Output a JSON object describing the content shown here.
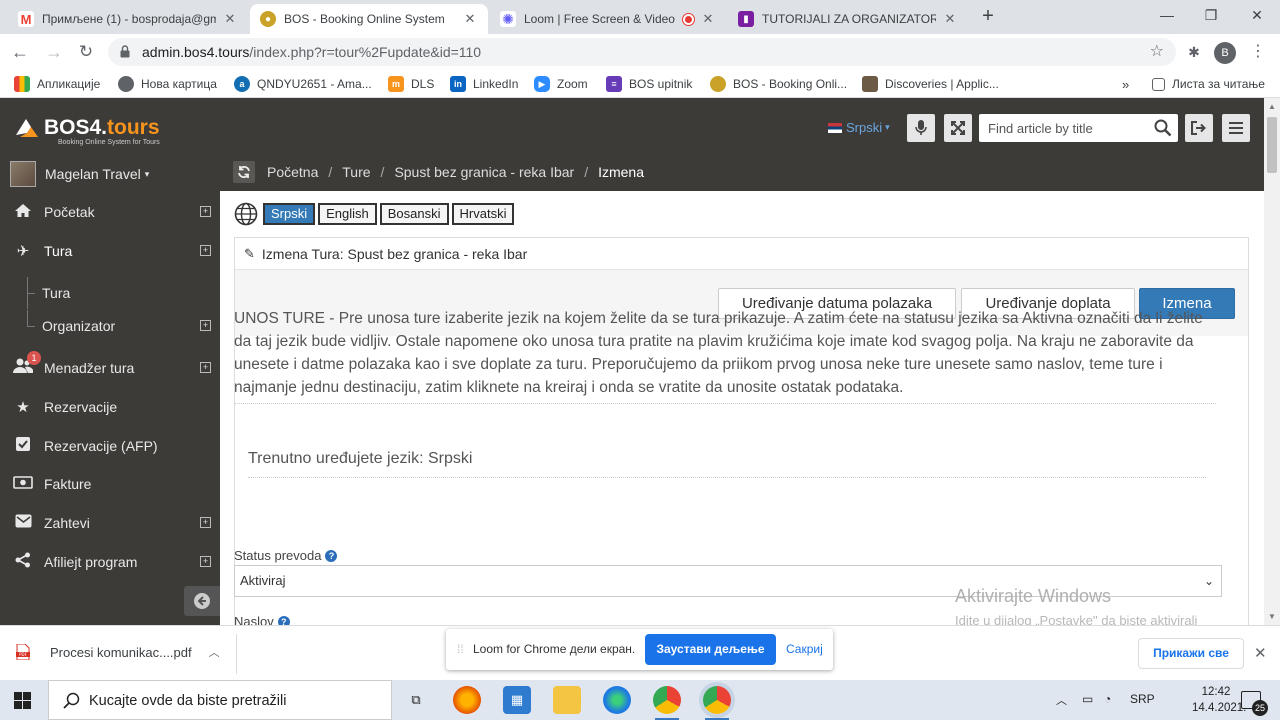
{
  "browser": {
    "tabs": [
      {
        "title": "Примљене (1) - bosprodaja@gm",
        "icon": "gmail-icon",
        "color": "#ea4335"
      },
      {
        "title": "BOS - Booking Online System",
        "icon": "bos-icon",
        "color": "#c9a227",
        "active": true
      },
      {
        "title": "Loom | Free Screen & Video",
        "icon": "loom-icon",
        "color": "#625df5"
      },
      {
        "title": "TUTORIJALI ZA ORGANIZATORE",
        "icon": "trello-icon",
        "color": "#7b1fa2"
      }
    ],
    "url_host": "admin.bos4.tours",
    "url_path": "/index.php?r=tour%2Fupdate&id=110",
    "profile_letter": "B",
    "bookmarks": [
      {
        "label": "Апликације",
        "icon": "apps-grid-icon"
      },
      {
        "label": "Нова картица",
        "icon": "globe-icon"
      },
      {
        "label": "QNDYU2651 - Ama...",
        "icon": "amazon-icon"
      },
      {
        "label": "DLS",
        "icon": "dls-icon"
      },
      {
        "label": "LinkedIn",
        "icon": "linkedin-icon"
      },
      {
        "label": "Zoom",
        "icon": "zoom-icon"
      },
      {
        "label": "BOS upitnik",
        "icon": "forms-icon"
      },
      {
        "label": "BOS - Booking Onli...",
        "icon": "bos-icon"
      },
      {
        "label": "Discoveries | Applic...",
        "icon": "discoveries-icon"
      }
    ],
    "reading_list": "Листа за читање",
    "overflow": "»"
  },
  "app": {
    "logo_text": "BOS4.",
    "logo_text_accent": "tours",
    "logo_sub": "Booking Online System for Tours",
    "language": "Srpski",
    "search_placeholder": "Find article by title",
    "user_name": "Magelan Travel",
    "breadcrumb": [
      "Početna",
      "Ture",
      "Spust bez granica - reka Ibar",
      "Izmena"
    ],
    "sidebar": [
      {
        "label": "Početak",
        "icon": "home-icon",
        "plus": true
      },
      {
        "label": "Tura",
        "icon": "plane-icon",
        "plus": true
      },
      {
        "label": "Tura",
        "sub": true
      },
      {
        "label": "Organizator",
        "sub": true,
        "plus": true
      },
      {
        "label": "Menadžer tura",
        "icon": "users-icon",
        "plus": true,
        "badge": "1"
      },
      {
        "label": "Rezervacije",
        "icon": "star-icon"
      },
      {
        "label": "Rezervacije (AFP)",
        "icon": "check-square-icon"
      },
      {
        "label": "Fakture",
        "icon": "money-icon"
      },
      {
        "label": "Zahtevi",
        "icon": "envelope-icon",
        "plus": true
      },
      {
        "label": "Afiliejt program",
        "icon": "share-icon",
        "plus": true
      }
    ],
    "lang_buttons": [
      "Srpski",
      "English",
      "Bosanski",
      "Hrvatski"
    ],
    "panel_title": "Izmena Tura: Spust bez granica - reka Ibar",
    "actions": [
      "Uređivanje datuma polazaka",
      "Uređivanje doplata",
      "Izmena"
    ],
    "info_text": "UNOS TURE - Pre unosa ture izaberite jezik na kojem želite da se tura prikazuje. A zatim ćete na statusu jezika sa Aktivna označiti da li želite da taj jezik bude vidljiv. Ostale napomene oko unosa tura pratite na plavim kružićima koje imate kod svagog polja. Na kraju ne zaboravite da unesete i datme polazaka kao i sve doplate za turu. Preporučujemo da priikom prvog unosa neke ture unesete samo naslov, teme ture i najmanje jednu destinaciju, zatim kliknete na kreiraj i onda se vratite da unosite ostatak podataka.",
    "current_lang_text": "Trenutno uređujete jezik: Srpski",
    "status_label": "Status prevoda",
    "status_value": "Aktiviraj",
    "title_label": "Naslov"
  },
  "overlay": {
    "watermark_title": "Aktivirajte Windows",
    "watermark_sub": "Idite u dijalog „Postavke\" da biste aktivirali Windows."
  },
  "downloads": {
    "file": "Procesi komunikac....pdf",
    "show_all": "Прикажи све"
  },
  "loom": {
    "message": "Loom for Chrome дели екран.",
    "stop": "Заустави дељење",
    "hide": "Сакриј"
  },
  "taskbar": {
    "search_placeholder": "Kucajte ovde da biste pretražili",
    "lang": "SRP",
    "time": "12:42",
    "date": "14.4.2021.",
    "notifications": "25"
  }
}
